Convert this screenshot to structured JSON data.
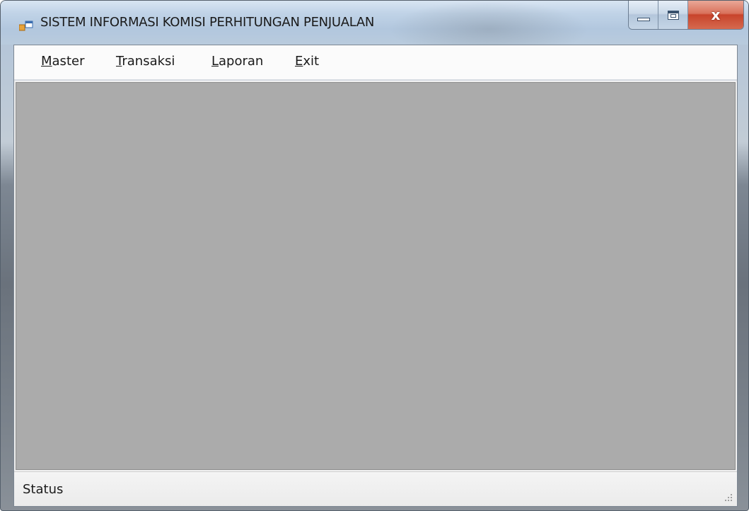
{
  "window": {
    "title": "SISTEM INFORMASI KOMISI PERHITUNGAN PENJUALAN",
    "icon": "app-form-icon",
    "buttons": {
      "minimize_icon": "minimize-icon",
      "maximize_icon": "maximize-icon",
      "close_icon": "close-icon",
      "close_glyph": "x"
    }
  },
  "menu": {
    "items": [
      {
        "accel": "M",
        "rest": "aster"
      },
      {
        "accel": "T",
        "rest": "ransaksi"
      },
      {
        "accel": "L",
        "rest": "aporan"
      },
      {
        "accel": "E",
        "rest": "xit"
      }
    ]
  },
  "statusbar": {
    "text": "Status",
    "grip_icon": "resize-grip-icon"
  },
  "colors": {
    "mdi_background": "#ababab",
    "close_button": "#c8432b",
    "menubar": "#fbfbfb"
  }
}
